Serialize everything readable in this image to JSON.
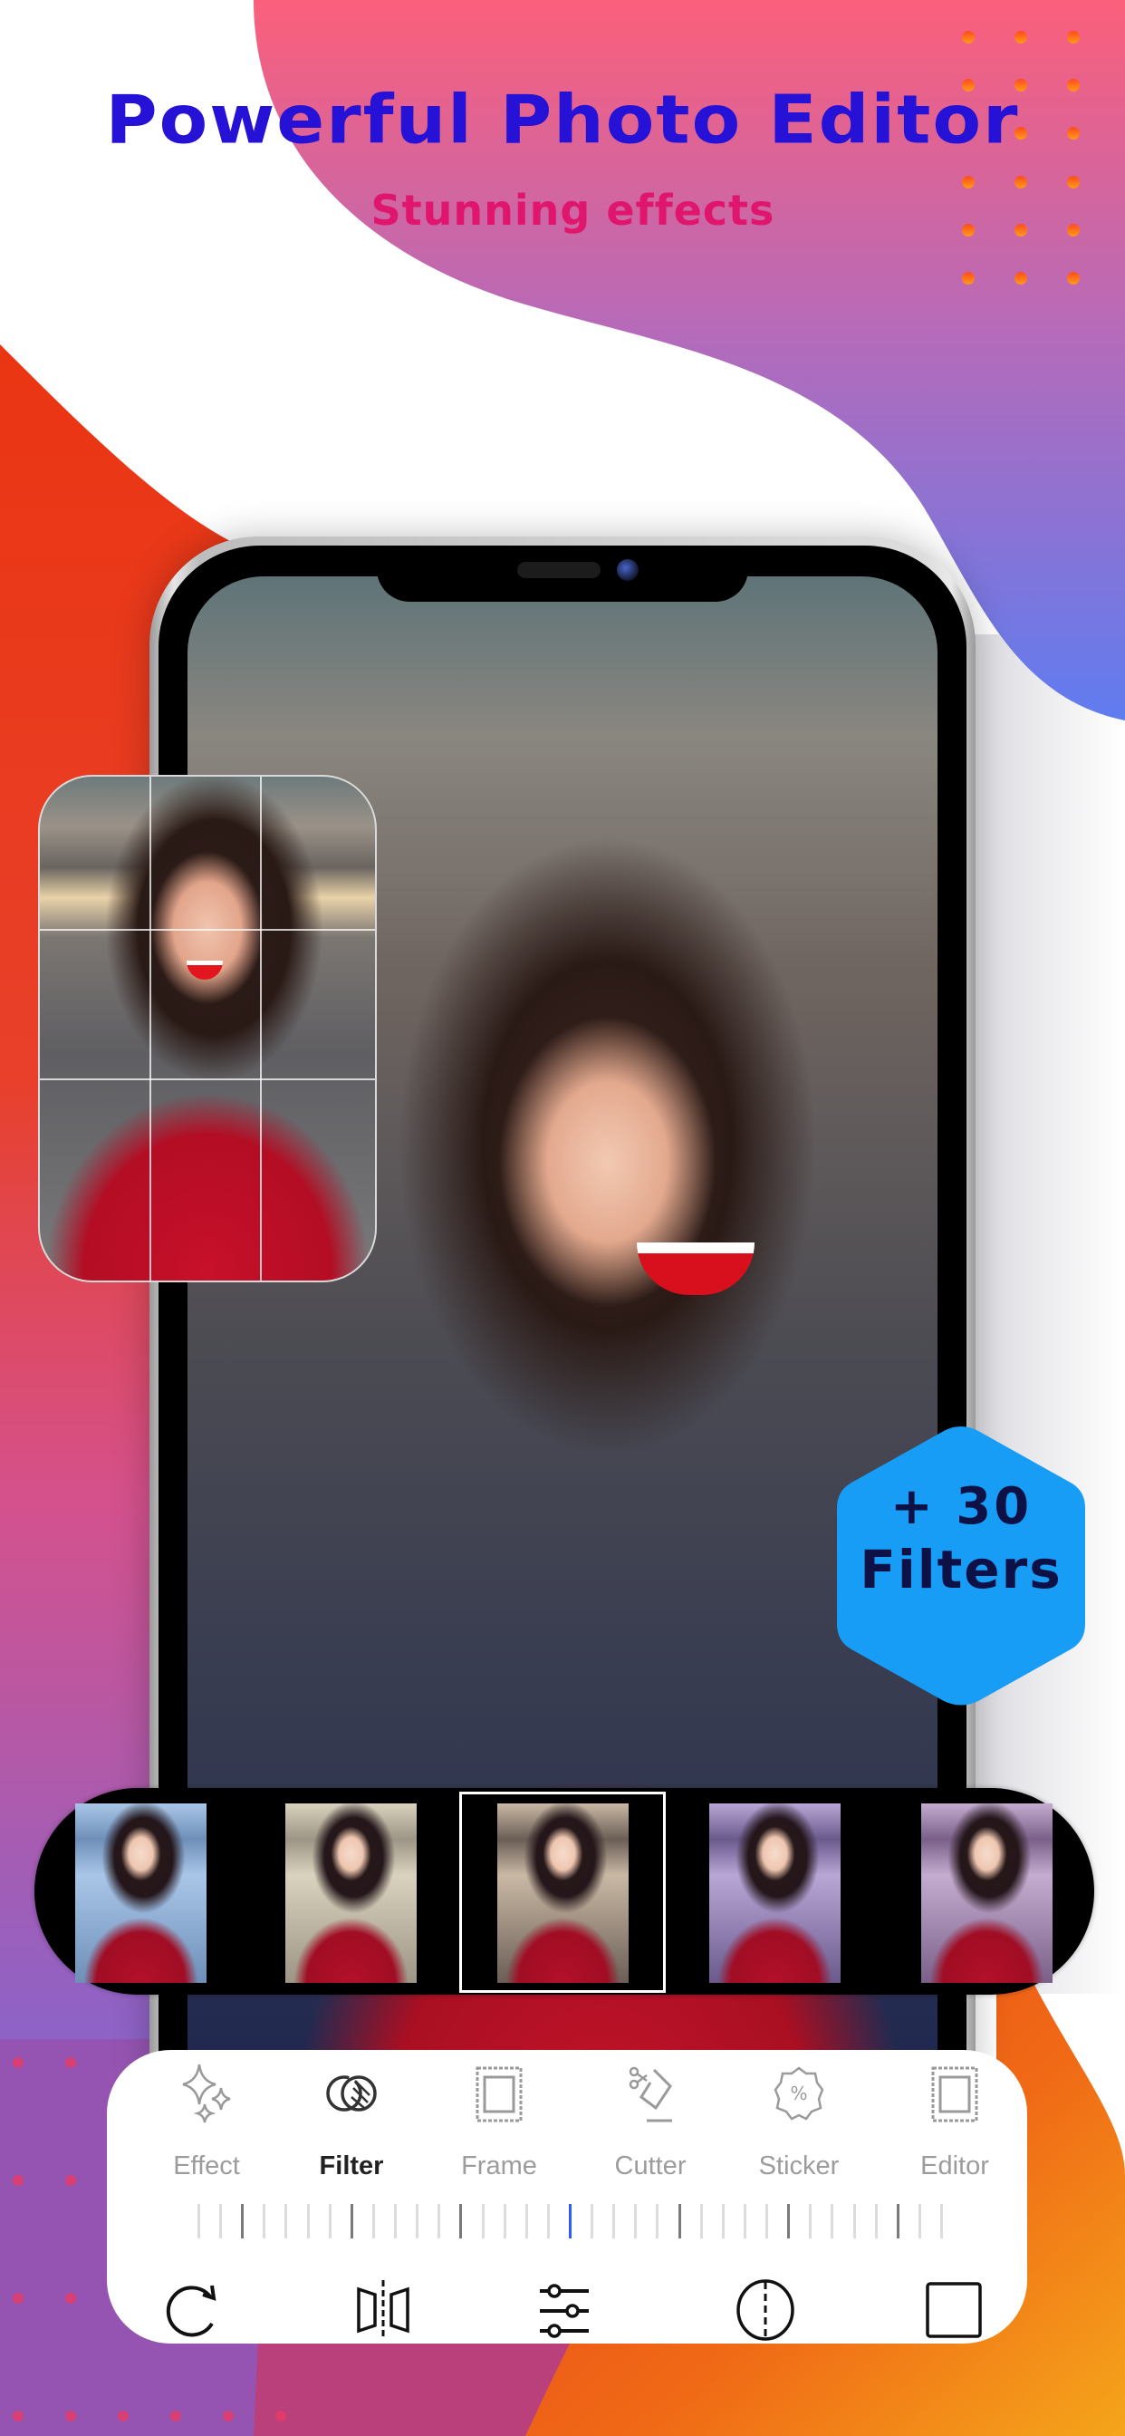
{
  "promo": {
    "headline": "Powerful Photo Editor",
    "subheadline": "Stunning effects",
    "badge_line1": "+ 30",
    "badge_line2": "Filters"
  },
  "colors": {
    "headline": "#2612d6",
    "subheadline": "#e0156d",
    "badge_fill": "#179df5",
    "badge_text": "#0e1145",
    "slider_current": "#2e5bff"
  },
  "filter_strip": {
    "thumbnails": [
      {
        "name": "cool"
      },
      {
        "name": "faded"
      },
      {
        "name": "original",
        "selected": true
      },
      {
        "name": "violet"
      },
      {
        "name": "warm-violet"
      }
    ]
  },
  "toolbar": {
    "tools": [
      {
        "label": "Effect",
        "icon": "sparkles-icon",
        "active": false
      },
      {
        "label": "Filter",
        "icon": "overlapping-circles-icon",
        "active": true
      },
      {
        "label": "Frame",
        "icon": "stamp-frame-icon",
        "active": false
      },
      {
        "label": "Cutter",
        "icon": "scissors-tag-icon",
        "active": false
      },
      {
        "label": "Sticker",
        "icon": "percent-badge-icon",
        "active": false
      },
      {
        "label": "Editor",
        "icon": "stamp-frame-icon",
        "active": false
      }
    ],
    "slider": {
      "tick_count": 35,
      "current_fraction": 0.5
    },
    "actions": [
      {
        "name": "rotate",
        "icon": "rotate-icon"
      },
      {
        "name": "flip",
        "icon": "flip-horizontal-icon"
      },
      {
        "name": "adjust",
        "icon": "sliders-icon"
      },
      {
        "name": "mirror",
        "icon": "ellipse-split-icon"
      },
      {
        "name": "aspect",
        "icon": "square-icon"
      }
    ]
  }
}
